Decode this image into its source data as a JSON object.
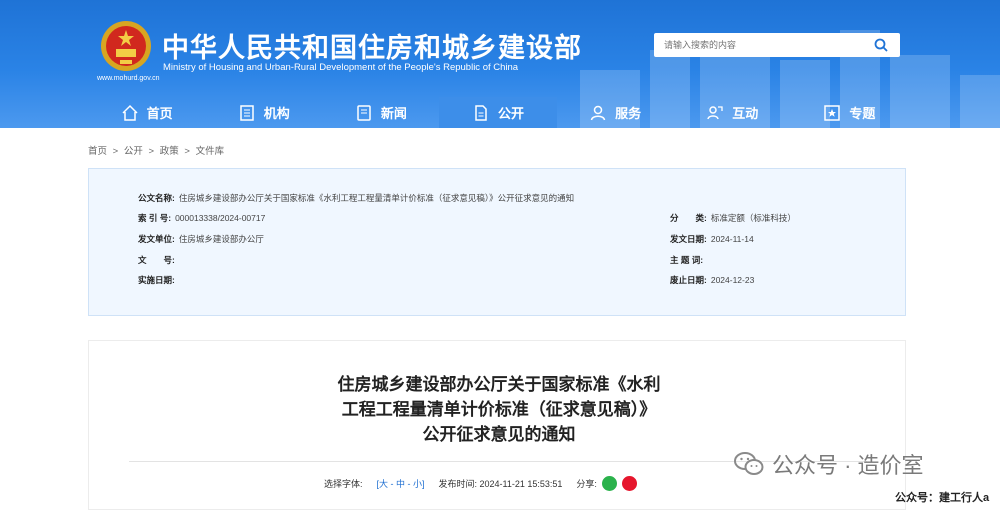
{
  "header": {
    "title": "中华人民共和国住房和城乡建设部",
    "subtitle": "Ministry of Housing and Urban-Rural Development of the People's Republic of China",
    "url": "www.mohurd.gov.cn",
    "search_placeholder": "请输入搜索的内容",
    "colors": {
      "primary": "#1f73d6",
      "nav_active": "#3d8ee9"
    }
  },
  "nav": [
    {
      "label": "首页",
      "icon": "home-icon"
    },
    {
      "label": "机构",
      "icon": "building-icon"
    },
    {
      "label": "新闻",
      "icon": "news-icon"
    },
    {
      "label": "公开",
      "icon": "document-icon",
      "active": true
    },
    {
      "label": "服务",
      "icon": "user-service-icon"
    },
    {
      "label": "互动",
      "icon": "interaction-icon"
    },
    {
      "label": "专题",
      "icon": "topic-icon"
    }
  ],
  "breadcrumb": [
    "首页",
    ">",
    "公开",
    ">",
    "政策",
    ">",
    "文件库"
  ],
  "info": {
    "name_label": "公文名称:",
    "name_value": "住房城乡建设部办公厅关于国家标准《水利工程工程量清单计价标准（征求意见稿）》公开征求意见的通知",
    "index_label": "索 引 号:",
    "index_value": "000013338/2024-00717",
    "unit_label": "发文单位:",
    "unit_value": "住房城乡建设部办公厅",
    "number_label": "文　　号:",
    "number_value": "",
    "impl_label": "实施日期:",
    "impl_value": "",
    "category_label": "分　　类:",
    "category_value": "标准定额（标准科技）",
    "date_label": "发文日期:",
    "date_value": "2024-11-14",
    "subject_label": "主 题 词:",
    "subject_value": "",
    "deadline_label": "废止日期:",
    "deadline_value": "2024-12-23"
  },
  "article": {
    "title_line1": "住房城乡建设部办公厅关于国家标准《水利",
    "title_line2": "工程工程量清单计价标准（征求意见稿）》",
    "title_line3": "公开征求意见的通知",
    "font_label": "选择字体:",
    "font_sizes": "[大 - 中 - 小]",
    "publish_time": "发布时间: 2024-11-21 15:53:51",
    "share_label": "分享:"
  },
  "watermark": {
    "text": "公众号 · 造价室",
    "footer": "公众号：建工行人a"
  }
}
